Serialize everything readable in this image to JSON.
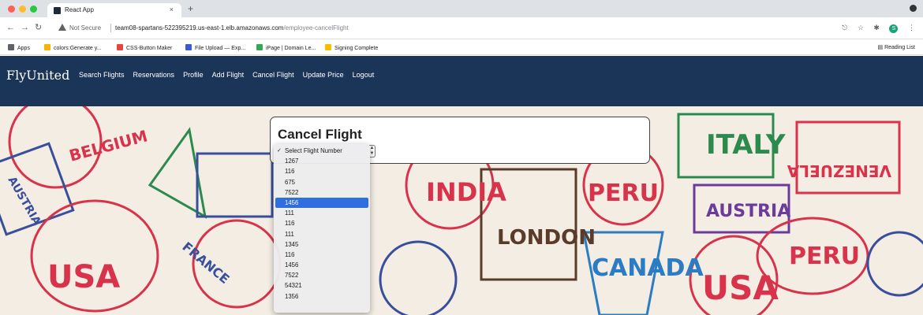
{
  "browser": {
    "tab_title": "React App",
    "tab_close": "×",
    "new_tab": "+",
    "not_secure": "Not Secure",
    "url_host": "team08-spartans-522395219.us-east-1.elb.amazonaws.com",
    "url_path": "/employee-cancelFlight",
    "profile_initial": "S",
    "bookmarks": [
      {
        "label": "Apps",
        "color": "#5f6368"
      },
      {
        "label": "colors:Generate y...",
        "color": "#f4b400"
      },
      {
        "label": "CSS-Button Maker",
        "color": "#e8453c"
      },
      {
        "label": "File Upload — Exp...",
        "color": "#3b5bdb"
      },
      {
        "label": "iPage | Domain Le...",
        "color": "#34a853"
      },
      {
        "label": "Signing Complete",
        "color": "#fbbc04"
      }
    ],
    "reading_list": "Reading List"
  },
  "app": {
    "brand": "FlyUnited",
    "nav": [
      "Search Flights",
      "Reservations",
      "Profile",
      "Add Flight",
      "Cancel Flight",
      "Update Price",
      "Logout"
    ],
    "nav_color": "#1b3558",
    "card_title": "Cancel Flight",
    "select": {
      "options": [
        "Select Flight Number",
        "1267",
        "116",
        "675",
        "7522",
        "1456",
        "111",
        "116",
        "111",
        "1345",
        "116",
        "1456",
        "7522",
        "54321",
        "1356"
      ],
      "checked_index": 0,
      "highlighted_index": 5
    }
  },
  "background_stamps": [
    "BELGIUM",
    "AUSTRIA",
    "USA",
    "INDIA",
    "LONDON",
    "ITALY",
    "PERU",
    "AUSTRIA",
    "CANADA",
    "USA",
    "PERU",
    "FRANCE",
    "VENEZUELA"
  ]
}
